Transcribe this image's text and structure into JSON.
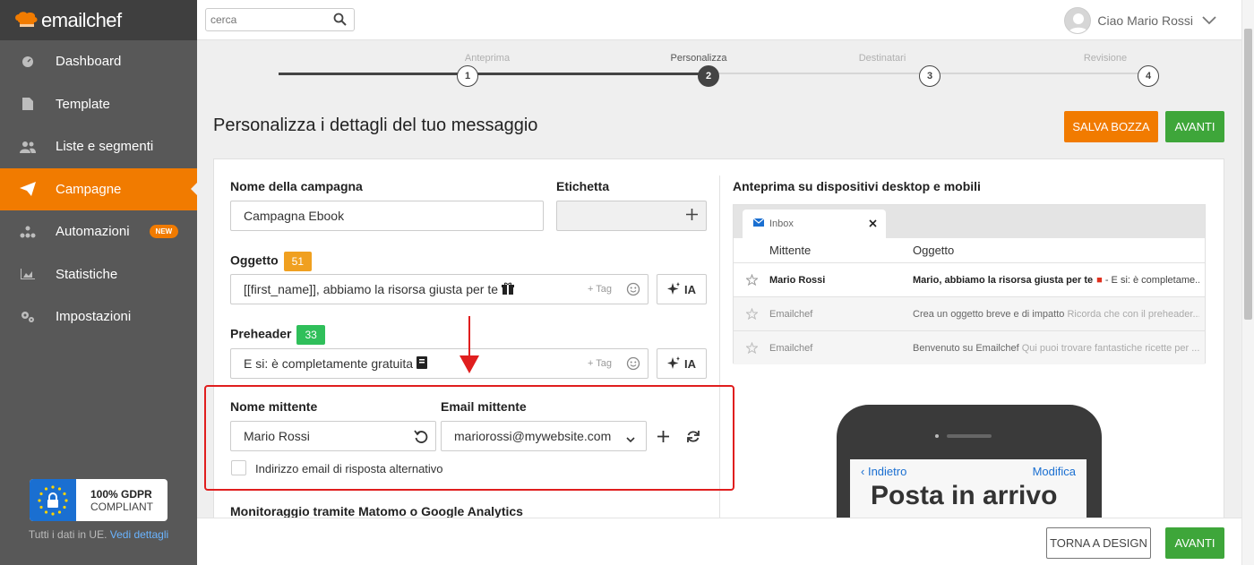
{
  "brand": {
    "name": "emailchef"
  },
  "sidebar": {
    "items": [
      {
        "label": "Dashboard",
        "icon": "dashboard-icon"
      },
      {
        "label": "Template",
        "icon": "template-icon"
      },
      {
        "label": "Liste e segmenti",
        "icon": "users-icon"
      },
      {
        "label": "Campagne",
        "icon": "paper-plane-icon",
        "active": true
      },
      {
        "label": "Automazioni",
        "icon": "automation-icon",
        "badge": "NEW"
      },
      {
        "label": "Statistiche",
        "icon": "chart-icon"
      },
      {
        "label": "Impostazioni",
        "icon": "gears-icon"
      }
    ],
    "gdpr": {
      "title": "100% GDPR",
      "subtitle": "COMPLIANT",
      "note": "Tutti i dati in UE.",
      "link": "Vedi dettagli"
    }
  },
  "topbar": {
    "search_placeholder": "cerca",
    "greeting": "Ciao Mario Rossi"
  },
  "stepper": {
    "steps": [
      {
        "label": "Anteprima",
        "number": "1"
      },
      {
        "label": "Personalizza",
        "number": "2",
        "current": true
      },
      {
        "label": "Destinatari",
        "number": "3"
      },
      {
        "label": "Revisione",
        "number": "4"
      }
    ]
  },
  "page": {
    "title": "Personalizza i dettagli del tuo messaggio",
    "save_draft": "SALVA BOZZA",
    "next": "AVANTI"
  },
  "form": {
    "campaign_name_label": "Nome della campagna",
    "campaign_name_value": "Campagna Ebook",
    "tag_label": "Etichetta",
    "subject_label": "Oggetto",
    "subject_count": "51",
    "subject_value": "[[first_name]], abbiamo la risorsa giusta per te",
    "tag_hint": "+ Tag",
    "ia_label": "IA",
    "preheader_label": "Preheader",
    "preheader_count": "33",
    "preheader_value": "E si: è completamente gratuita",
    "sender_name_label": "Nome mittente",
    "sender_name_value": "Mario Rossi",
    "sender_email_label": "Email mittente",
    "sender_email_value": "mariorossi@mywebsite.com",
    "reply_to_label": "Indirizzo email di risposta alternativo",
    "tracking_label": "Monitoraggio tramite Matomo o Google Analytics"
  },
  "preview": {
    "title": "Anteprima su dispositivi desktop e mobili",
    "tab_label": "Inbox",
    "col_sender": "Mittente",
    "col_subject": "Oggetto",
    "rows": [
      {
        "sender": "Mario Rossi",
        "subject": "Mario, abbiamo la risorsa giusta per te",
        "snippet": " - E si: è completame..."
      },
      {
        "sender": "Emailchef",
        "subject": "Crea un oggetto breve e di impatto",
        "snippet": " Ricorda che con il preheader..."
      },
      {
        "sender": "Emailchef",
        "subject": "Benvenuto su Emailchef",
        "snippet": " Qui puoi trovare fantastiche ricette per ..."
      }
    ],
    "phone": {
      "back": "Indietro",
      "edit": "Modifica",
      "heading": "Posta in arrivo"
    }
  },
  "footer": {
    "back_design": "TORNA A DESIGN",
    "next": "AVANTI"
  },
  "colors": {
    "accent": "#f17b00",
    "green": "#3ea63a",
    "sidebar": "#585858",
    "highlight": "#e01e1e"
  }
}
